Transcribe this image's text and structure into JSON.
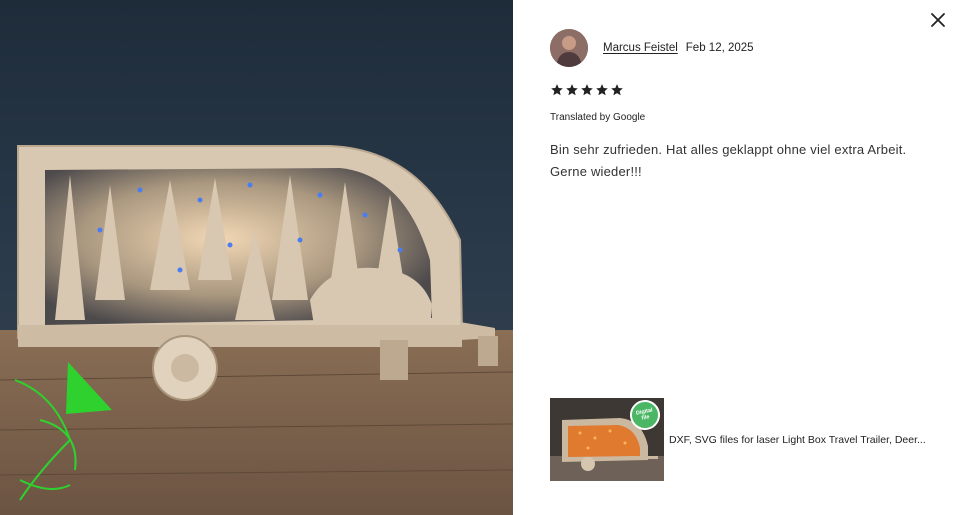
{
  "review": {
    "reviewer_name": "Marcus Feistel",
    "date": "Feb 12, 2025",
    "rating": 5,
    "rating_max": 5,
    "translated_label": "Translated by Google",
    "text": "Bin sehr zufrieden. Hat alles geklappt ohne viel extra Arbeit. Gerne wieder!!!"
  },
  "product": {
    "title": "DXF, SVG files for laser Light Box Travel Trailer, Deer...",
    "badge": "Digital file"
  },
  "icons": {
    "close": "close-icon",
    "star": "star-icon"
  },
  "colors": {
    "star": "#222222",
    "badge": "#4bb764",
    "logo_green": "#2fd12f"
  }
}
